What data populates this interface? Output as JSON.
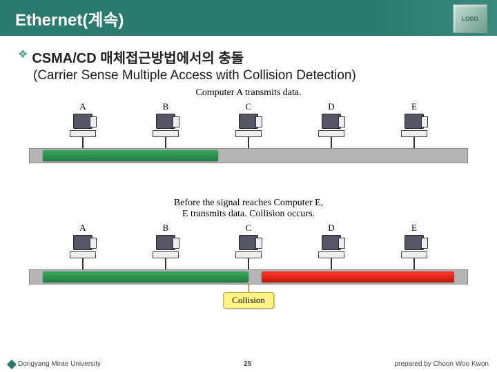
{
  "title": "Ethernet(계속)",
  "logo": "LOGO",
  "bullet_glyph": "❖",
  "heading": "CSMA/CD 매체접근방법에서의 충돌",
  "subheading": "(Carrier Sense Multiple Access with Collision Detection)",
  "diagram": {
    "caption1": "Computer A transmits data.",
    "caption2_line1": "Before the signal reaches Computer E,",
    "caption2_line2": "E transmits data. Collision occurs.",
    "nodes": [
      "A",
      "B",
      "C",
      "D",
      "E"
    ],
    "collision_label": "Collision"
  },
  "footer": {
    "left": "Dongyang Mirae University",
    "center": "25",
    "right": "prepared by Choon Woo Kwon"
  }
}
